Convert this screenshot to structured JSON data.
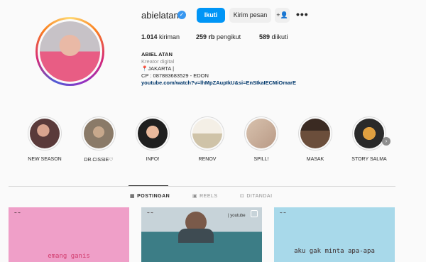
{
  "profile": {
    "username": "abielatan",
    "follow_label": "Ikuti",
    "message_label": "Kirim pesan",
    "stats": {
      "posts_count": "1.014",
      "posts_label": "kiriman",
      "followers_count": "259 rb",
      "followers_label": "pengikut",
      "following_count": "589",
      "following_label": "diikuti"
    },
    "bio": {
      "name": "ABIEL ATAN",
      "category": "Kreator digital",
      "location": "📍JAKARTA |",
      "contact": "CP : 087883683529 - EDON",
      "link": "youtube.com/watch?v=lhMpZAupIkU&si=EnSIkaIECMiOmarE"
    }
  },
  "highlights": [
    {
      "label": "NEW SEASON",
      "color": "#5a3a3a"
    },
    {
      "label": "DR.CISSIE♡",
      "color": "#8a7a68"
    },
    {
      "label": "INFO!",
      "color": "#1f1f1f"
    },
    {
      "label": "RENOV",
      "color": "#cfc3a8"
    },
    {
      "label": "SPILL!",
      "color": "#b99a86"
    },
    {
      "label": "MASAK",
      "color": "#6b4e3b"
    },
    {
      "label": "STORY SALMA",
      "color": "#2a2a2a"
    }
  ],
  "tabs": [
    {
      "label": "POSTINGAN",
      "icon": "grid-icon"
    },
    {
      "label": "REELS",
      "icon": "reels-icon"
    },
    {
      "label": "DITANDAI",
      "icon": "tagged-icon"
    }
  ],
  "posts": [
    {
      "text": "emang ganis"
    },
    {
      "tag": "| youtube"
    },
    {
      "text": "aku gak minta apa-apa"
    }
  ],
  "colors": {
    "accent": "#0095f6",
    "verified": "#3897f0",
    "link": "#00376b"
  }
}
